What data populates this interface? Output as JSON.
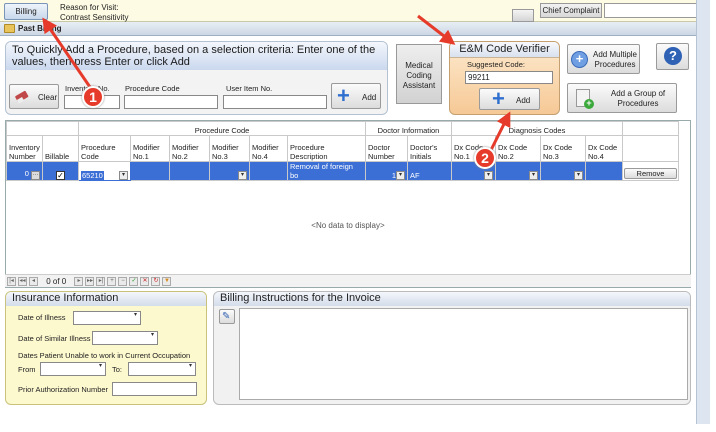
{
  "top": {
    "billing_tab": "Billing",
    "reason_label": "Reason for Visit:",
    "reason_value": "Contrast Sensitivity",
    "chief_complaint": "Chief Complaint"
  },
  "past_billing": {
    "label": "Past Billing"
  },
  "quick_add": {
    "title": "To Quickly Add a Procedure, based on a selection criteria: Enter one of the values, then press Enter or click Add",
    "clear": "Clear",
    "inventory_label": "Inventory No.",
    "procedure_label": "Procedure Code",
    "user_item_label": "User Item No.",
    "add": "Add"
  },
  "medical_coding": "Medical Coding Assistant",
  "em_verifier": {
    "title": "E&M Code Verifier",
    "suggested_label": "Suggested Code:",
    "suggested_value": "99211",
    "add": "Add"
  },
  "right_buttons": {
    "add_multiple": "Add Multiple Procedures",
    "add_group": "Add a Group of Procedures",
    "help": "?"
  },
  "grid": {
    "group_headers": {
      "procedure_code": "Procedure Code",
      "doctor_info": "Doctor Information",
      "diagnosis_codes": "Diagnosis Codes"
    },
    "columns": [
      "Inventory Number",
      "Billable",
      "Procedure Code",
      "Modifier No.1",
      "Modifier No.2",
      "Modifier No.3",
      "Modifier No.4",
      "Procedure Description",
      "Doctor Number",
      "Doctor's Initials",
      "Dx Code No.1",
      "Dx Code No.2",
      "Dx Code No.3",
      "Dx Code No.4"
    ],
    "row": {
      "inventory": "0",
      "procedure_code": "65210",
      "description": "Removal of foreign bo",
      "doctor_number": "1",
      "initials": "AF",
      "remove": "Remove"
    },
    "empty_text": "<No data to display>",
    "pager": "0 of 0"
  },
  "insurance": {
    "title": "Insurance Information",
    "date_illness": "Date of Illness",
    "date_similar": "Date of Similar Illness",
    "dates_unable": "Dates Patient Unable to work in Current Occupation",
    "from": "From",
    "to": "To:",
    "prior_auth": "Prior Authorization Number"
  },
  "billing_instructions": {
    "title": "Billing Instructions for the Invoice"
  },
  "callouts": {
    "one": "1",
    "two": "2"
  },
  "colors": {
    "arrow": "#e63b2a",
    "selected_row": "#3b6fd6",
    "accent_blue": "#2f6fcf"
  }
}
